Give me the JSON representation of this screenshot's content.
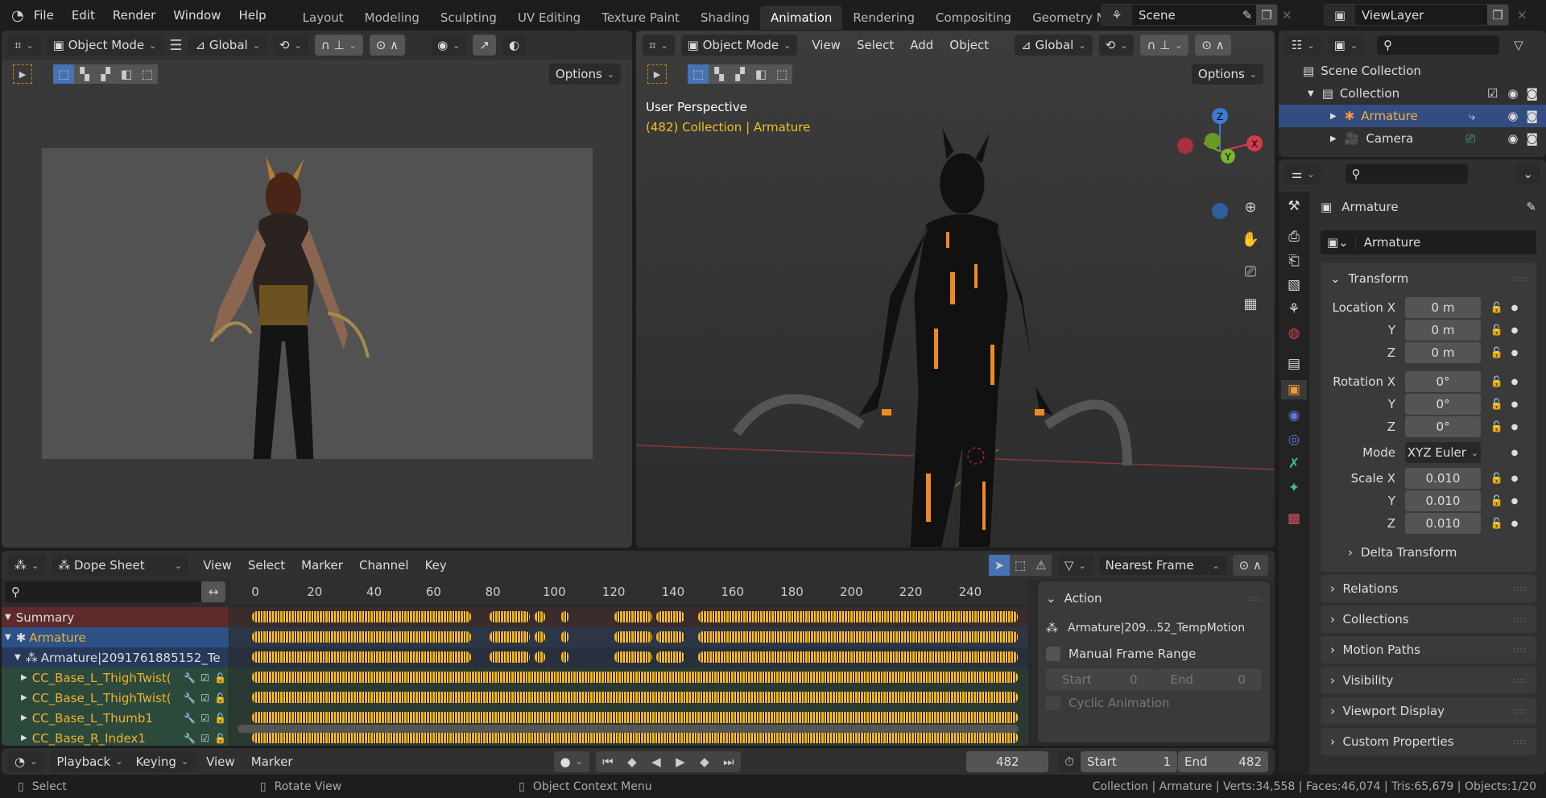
{
  "topbar": {
    "menus": [
      "File",
      "Edit",
      "Render",
      "Window",
      "Help"
    ],
    "workspaces": [
      "Layout",
      "Modeling",
      "Sculpting",
      "UV Editing",
      "Texture Paint",
      "Shading",
      "Animation",
      "Rendering",
      "Compositing",
      "Geometry Node"
    ],
    "active_workspace": "Animation",
    "scene": "Scene",
    "view_layer": "ViewLayer"
  },
  "viewport_left": {
    "mode": "Object Mode",
    "orientation": "Global",
    "options": "Options"
  },
  "viewport_right": {
    "mode": "Object Mode",
    "menus": [
      "View",
      "Select",
      "Add",
      "Object"
    ],
    "orientation": "Global",
    "options": "Options",
    "overlay_title": "User Perspective",
    "overlay_sub": "(482) Collection | Armature",
    "gizmo": {
      "z": "Z",
      "y": "Y",
      "x": "X"
    }
  },
  "outliner": {
    "items": [
      {
        "label": "Scene Collection"
      },
      {
        "label": "Collection"
      },
      {
        "label": "Armature"
      },
      {
        "label": "Camera"
      }
    ]
  },
  "properties": {
    "object_name": "Armature",
    "datablock": "Armature",
    "transform_title": "Transform",
    "location": {
      "label": "Location X",
      "x": "0 m",
      "y": "0 m",
      "z": "0 m"
    },
    "rotation": {
      "label": "Rotation X",
      "x": "0°",
      "y": "0°",
      "z": "0°"
    },
    "mode_label": "Mode",
    "mode": "XYZ Euler",
    "scale": {
      "label": "Scale X",
      "x": "0.010",
      "y": "0.010",
      "z": "0.010"
    },
    "axis_y": "Y",
    "axis_z": "Z",
    "delta": "Delta Transform",
    "panels": [
      "Relations",
      "Collections",
      "Motion Paths",
      "Visibility",
      "Viewport Display",
      "Custom Properties"
    ]
  },
  "dopesheet": {
    "editor": "Dope Sheet",
    "menus": [
      "View",
      "Select",
      "Marker",
      "Channel",
      "Key"
    ],
    "snap": "Nearest Frame",
    "ticks": [
      0,
      20,
      40,
      60,
      80,
      100,
      120,
      140,
      160,
      180,
      200,
      220,
      240
    ],
    "channels": [
      {
        "label": "Summary",
        "type": "summary"
      },
      {
        "label": "Armature",
        "type": "object"
      },
      {
        "label": "Armature|2091761885152_Te",
        "type": "action"
      },
      {
        "label": "CC_Base_L_ThighTwist(",
        "type": "group"
      },
      {
        "label": "CC_Base_L_ThighTwist(",
        "type": "group"
      },
      {
        "label": "CC_Base_L_Thumb1",
        "type": "group"
      },
      {
        "label": "CC_Base_R_Index1",
        "type": "group"
      }
    ],
    "sparse_key_ranges": [
      [
        0,
        72
      ],
      [
        80,
        92
      ],
      [
        95,
        97
      ],
      [
        104,
        105
      ],
      [
        122,
        133
      ],
      [
        136,
        144
      ],
      [
        150,
        256
      ]
    ],
    "dense_key_ranges": [
      [
        0,
        256
      ]
    ],
    "action_panel": {
      "title": "Action",
      "action_name": "Armature|209...52_TempMotion",
      "manual_frame_range": "Manual Frame Range",
      "start_label": "Start",
      "start": "0",
      "end_label": "End",
      "end": "0",
      "cyclic": "Cyclic Animation"
    }
  },
  "timeline": {
    "menus": [
      "Playback",
      "Keying",
      "View",
      "Marker"
    ],
    "current_frame": "482",
    "start_label": "Start",
    "start": "1",
    "end_label": "End",
    "end": "482"
  },
  "statusbar": {
    "select": "Select",
    "rotate": "Rotate View",
    "context": "Object Context Menu",
    "stats": "Collection | Armature | Verts:34,558 | Faces:46,074 | Tris:65,679 | Objects:1/20"
  }
}
